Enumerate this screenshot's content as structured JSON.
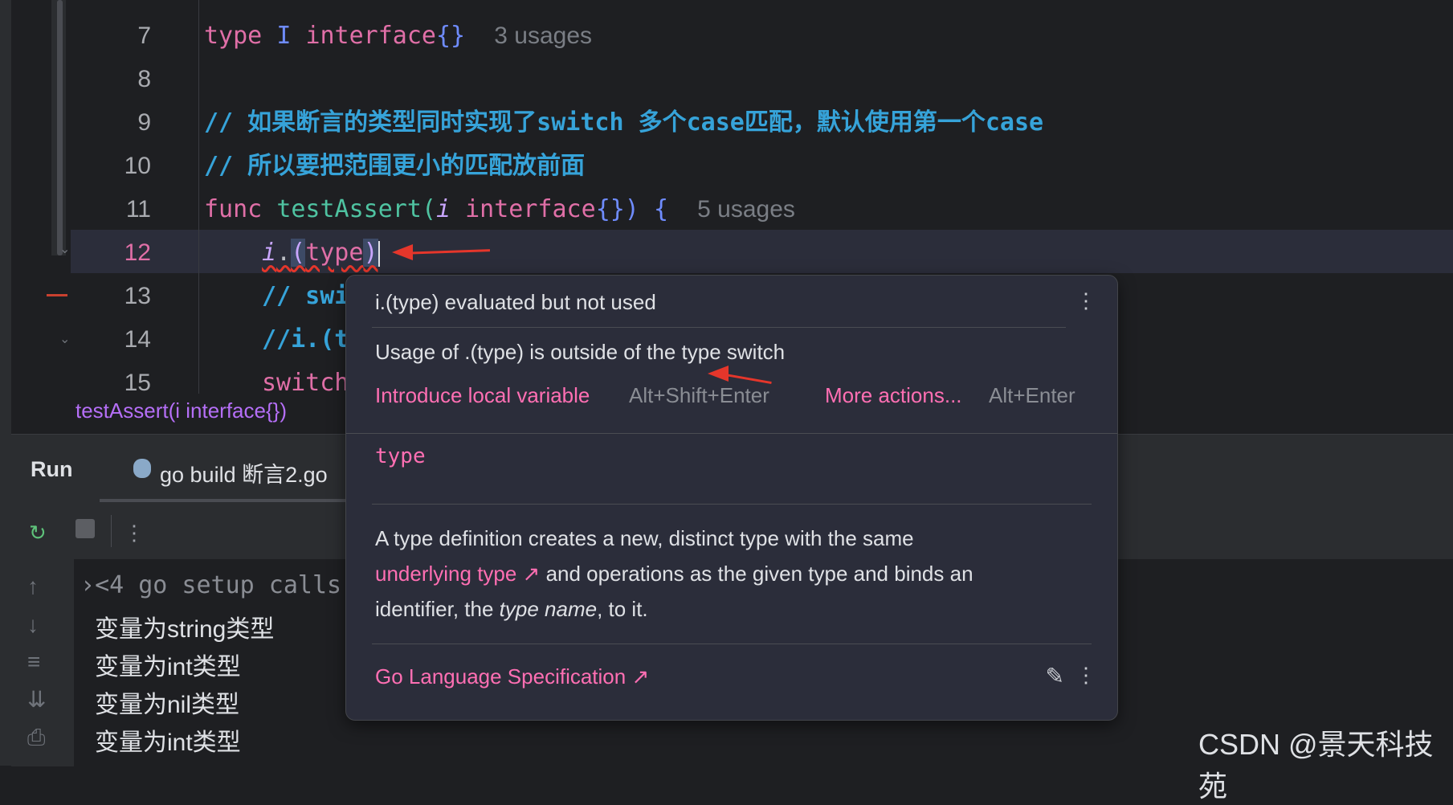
{
  "editor": {
    "line_numbers": [
      "7",
      "8",
      "9",
      "10",
      "11",
      "12",
      "13",
      "14",
      "15"
    ],
    "active_line": "12",
    "line7": {
      "kw": "type",
      "name": "I",
      "iface": "interface",
      "braces": "{}",
      "usages": "3 usages"
    },
    "line9_comment": "// 如果断言的类型同时实现了switch 多个case匹配，默认使用第一个case",
    "line10_comment": "// 所以要把范围更小的匹配放前面",
    "line11": {
      "kw": "func",
      "name": "testAssert",
      "open": "(",
      "param": "i",
      "iface": "interface",
      "close": "{})",
      "brace": "{",
      "usages": "5 usages"
    },
    "line12": {
      "var": "i",
      "dot": ".",
      "paren_open": "(",
      "type_kw": "type",
      "paren_close": ")"
    },
    "line13_partial": "// swi",
    "line14_partial": "//i.(t",
    "line15_partial": "switch",
    "breadcrumb": "testAssert(i interface{})"
  },
  "run_panel": {
    "title": "Run",
    "tab_label": "go build 断言2.go",
    "toolbar": {
      "rerun_icon": "rerun-icon",
      "stop_icon": "stop-icon",
      "more_icon": "more-vertical-icon"
    },
    "side_icons": [
      "arrow-up-icon",
      "arrow-down-icon",
      "soft-wrap-icon",
      "scroll-to-end-icon",
      "print-icon"
    ],
    "output": [
      "<4 go setup calls",
      "变量为string类型",
      "变量为int类型",
      "变量为nil类型",
      "变量为int类型"
    ]
  },
  "popup": {
    "title": "i.(type) evaluated but not used",
    "description": "Usage of .(type) is outside of the type switch",
    "action1": "Introduce local variable",
    "action1_shortcut": "Alt+Shift+Enter",
    "action2": "More actions...",
    "action2_shortcut": "Alt+Enter",
    "doc_keyword": "type",
    "doc_text_1": "A type definition creates a new, distinct type with the same",
    "doc_link": "underlying type ↗",
    "doc_text_2": " and operations as the given type and binds an",
    "doc_text_3a": "identifier, the ",
    "doc_text_3_italic": "type name",
    "doc_text_3b": ", to it.",
    "spec_link": "Go Language Specification ↗"
  },
  "watermark": "CSDN @景天科技苑",
  "colors": {
    "keyword": "#e06fa7",
    "function": "#4fc3a1",
    "comment": "#36a3d9",
    "link": "#ff6fb3",
    "arrow": "#e5362b"
  }
}
